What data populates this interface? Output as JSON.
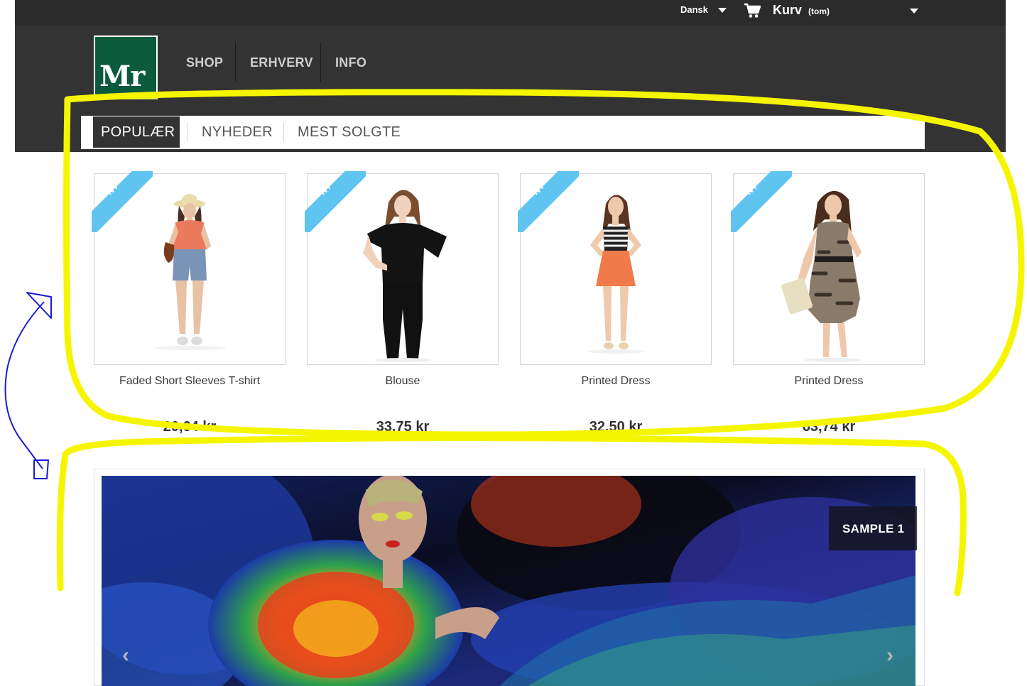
{
  "topbar": {
    "language": "Dansk",
    "cart_label": "Kurv",
    "cart_status": "(tom)"
  },
  "logo": {
    "text": "Mr",
    "color": "#0c5a3c"
  },
  "main_nav": [
    {
      "label": "SHOP"
    },
    {
      "label": "ERHVERV"
    },
    {
      "label": "INFO"
    }
  ],
  "tabs": [
    {
      "label": "POPULÆR",
      "active": true
    },
    {
      "label": "NYHEDER",
      "active": false
    },
    {
      "label": "MEST SOLGTE",
      "active": false
    }
  ],
  "products": [
    {
      "badge": "NY",
      "name": "Faded Short Sleeves T-shirt",
      "price": "20,64 kr"
    },
    {
      "badge": "NY",
      "name": "Blouse",
      "price": "33,75 kr"
    },
    {
      "badge": "NY",
      "name": "Printed Dress",
      "price": "32,50 kr"
    },
    {
      "badge": "NY",
      "name": "Printed Dress",
      "price": "63,74 kr"
    }
  ],
  "slider": {
    "caption": "SAMPLE 1",
    "prev_icon": "chevron-left-icon",
    "next_icon": "chevron-right-icon"
  },
  "colors": {
    "header_bg": "#333333",
    "badge": "#5fc4f0",
    "annotation_highlight": "#f5f500",
    "annotation_arrow": "#1a1ad6"
  }
}
